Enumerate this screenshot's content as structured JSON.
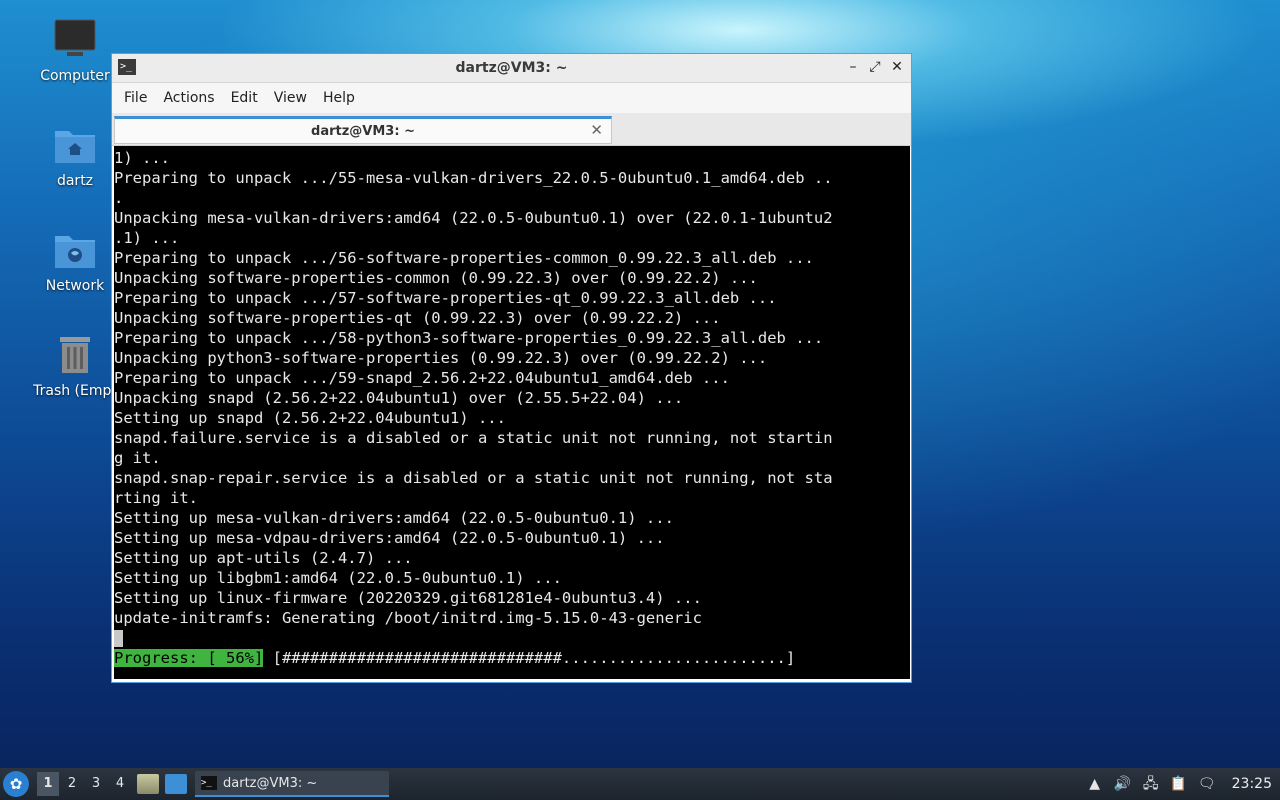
{
  "desktop": {
    "icons": [
      {
        "label": "Computer"
      },
      {
        "label": "dartz"
      },
      {
        "label": "Network"
      },
      {
        "label": "Trash (Empt"
      }
    ]
  },
  "window": {
    "title": "dartz@VM3: ~",
    "controls": {
      "minimize": "–",
      "maximize": "⤢",
      "close": "✕"
    },
    "menu": [
      "File",
      "Actions",
      "Edit",
      "View",
      "Help"
    ],
    "tab": {
      "label": "dartz@VM3: ~",
      "close": "✕"
    }
  },
  "terminal": {
    "lines": [
      "1) ...",
      "Preparing to unpack .../55-mesa-vulkan-drivers_22.0.5-0ubuntu0.1_amd64.deb ..",
      ".",
      "Unpacking mesa-vulkan-drivers:amd64 (22.0.5-0ubuntu0.1) over (22.0.1-1ubuntu2",
      ".1) ...",
      "Preparing to unpack .../56-software-properties-common_0.99.22.3_all.deb ...",
      "Unpacking software-properties-common (0.99.22.3) over (0.99.22.2) ...",
      "Preparing to unpack .../57-software-properties-qt_0.99.22.3_all.deb ...",
      "Unpacking software-properties-qt (0.99.22.3) over (0.99.22.2) ...",
      "Preparing to unpack .../58-python3-software-properties_0.99.22.3_all.deb ...",
      "Unpacking python3-software-properties (0.99.22.3) over (0.99.22.2) ...",
      "Preparing to unpack .../59-snapd_2.56.2+22.04ubuntu1_amd64.deb ...",
      "Unpacking snapd (2.56.2+22.04ubuntu1) over (2.55.5+22.04) ...",
      "Setting up snapd (2.56.2+22.04ubuntu1) ...",
      "snapd.failure.service is a disabled or a static unit not running, not startin",
      "g it.",
      "snapd.snap-repair.service is a disabled or a static unit not running, not sta",
      "rting it.",
      "Setting up mesa-vulkan-drivers:amd64 (22.0.5-0ubuntu0.1) ...",
      "Setting up mesa-vdpau-drivers:amd64 (22.0.5-0ubuntu0.1) ...",
      "Setting up apt-utils (2.4.7) ...",
      "Setting up libgbm1:amd64 (22.0.5-0ubuntu0.1) ...",
      "Setting up linux-firmware (20220329.git681281e4-0ubuntu3.4) ...",
      "update-initramfs: Generating /boot/initrd.img-5.15.0-43-generic"
    ],
    "progress_label": "Progress: [ 56%]",
    "progress_bar": " [##############################........................]"
  },
  "taskbar": {
    "workspaces": [
      "1",
      "2",
      "3",
      "4"
    ],
    "active_workspace": "1",
    "task_label": "dartz@VM3: ~",
    "clock": "23:25"
  }
}
